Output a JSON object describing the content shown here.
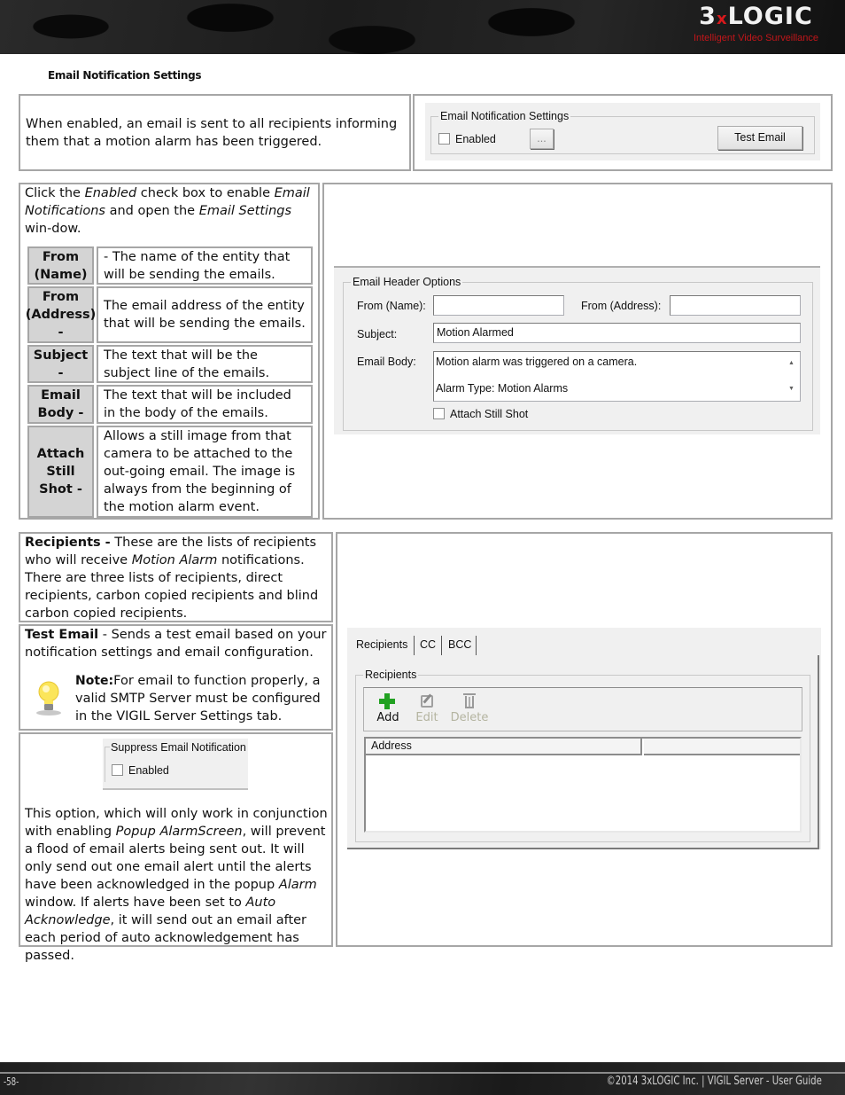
{
  "header": {
    "logo_main": "3",
    "logo_x": "x",
    "logo_rest": "LOGIC",
    "logo_tagline": "Intelligent Video Surveillance"
  },
  "section_title": "Email Notification Settings",
  "row1": {
    "description": "When enabled, an email is sent to all recipients informing them that a motion alarm has been triggered.",
    "screenshot": {
      "group_title": "Email Notification Settings",
      "enabled_label": "Enabled",
      "enabled_checked": false,
      "ellipsis_button": "...",
      "test_email_button": "Test Email"
    }
  },
  "row2": {
    "intro_parts": [
      "Click the ",
      "Enabled",
      " check box to enable ",
      "Email Notifications",
      " and open the ",
      "Email Settings",
      " win-dow."
    ],
    "definitions": [
      {
        "term": "From (Name)",
        "desc": "- The name of the entity that will be sending the emails."
      },
      {
        "term": "From (Address) -",
        "desc": "The email address of the entity that will be sending the emails."
      },
      {
        "term": "Subject -",
        "desc": "The text that will be the subject line of the emails."
      },
      {
        "term": "Email Body -",
        "desc": "The text that will be included in the body of the emails."
      },
      {
        "term": "Attach Still Shot -",
        "desc": "Allows a still image from that camera to be attached to the out-going email. The image is always from the beginning of the motion alarm event."
      }
    ],
    "screenshot": {
      "group_title": "Email Header Options",
      "from_name_label": "From (Name):",
      "from_name_value": "",
      "from_address_label": "From (Address):",
      "from_address_value": "",
      "subject_label": "Subject:",
      "subject_value": "Motion Alarmed",
      "body_label": "Email Body:",
      "body_line1": "Motion alarm was triggered on a camera.",
      "body_line2": "Alarm Type: Motion Alarms",
      "attach_label": "Attach Still Shot",
      "attach_checked": false
    }
  },
  "row3": {
    "recipients_term": "Recipients -",
    "recipients_parts": [
      " These are the lists of recipients who will receive ",
      "Motion Alarm",
      " notifications. There are three lists of recipients, direct recipients, carbon copied recipients and blind carbon copied recipients."
    ],
    "test_term": "Test Email",
    "test_desc": " - Sends a test email based on your notification settings and email configuration.",
    "note_label": "Note:",
    "note_text": "For email to function properly, a valid SMTP Server must be configured in the VIGIL Server Settings tab.",
    "suppress": {
      "group_title": "Suppress Email Notification",
      "enabled_label": "Enabled",
      "enabled_checked": false
    },
    "suppress_parts": [
      "This option, which will only work in conjunction with enabling ",
      "Popup AlarmScreen",
      ", will prevent a flood of email alerts being sent out. It will only send out one email alert until the alerts have been acknowledged in the popup ",
      "Alarm",
      " window. If alerts have been set to ",
      "Auto Acknowledge",
      ", it will send out an email after each period of auto acknowledgement has passed."
    ],
    "screenshot": {
      "tabs": [
        "Recipients",
        "CC",
        "BCC"
      ],
      "active_tab": "Recipients",
      "group_title": "Recipients",
      "tools": [
        {
          "label": "Add",
          "icon": "plus-icon",
          "enabled": true
        },
        {
          "label": "Edit",
          "icon": "edit-icon",
          "enabled": false
        },
        {
          "label": "Delete",
          "icon": "trash-icon",
          "enabled": false
        }
      ],
      "columns": [
        "Address",
        ""
      ],
      "rows": []
    }
  },
  "footer": {
    "page": "-58-",
    "copyright": "©2014 3xLOGIC Inc. | VIGIL Server - User Guide"
  }
}
